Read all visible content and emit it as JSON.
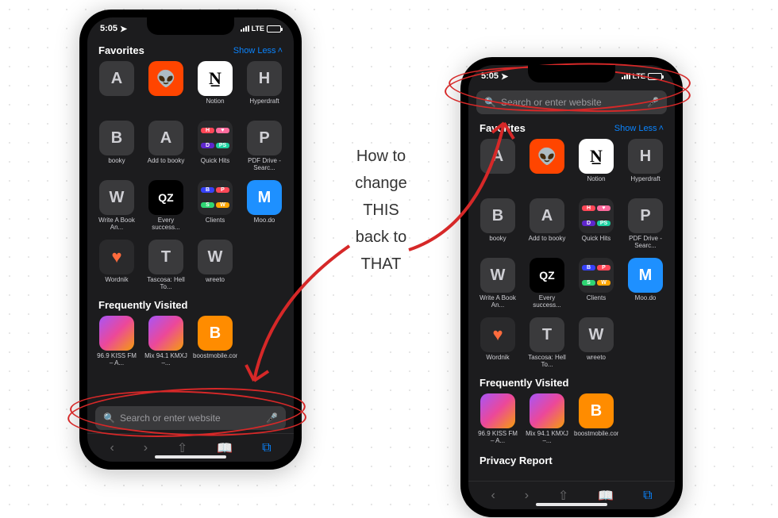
{
  "status": {
    "time": "5:05",
    "net": "LTE"
  },
  "search": {
    "placeholder": "Search or enter website"
  },
  "sections": {
    "favorites": "Favorites",
    "show_less": "Show Less",
    "frequently": "Frequently Visited",
    "privacy": "Privacy Report"
  },
  "favorites": [
    {
      "letter": "A",
      "label": "",
      "style": ""
    },
    {
      "letter": "👽",
      "label": "",
      "style": "reddit"
    },
    {
      "letter": "N",
      "label": "Notion",
      "style": "notion"
    },
    {
      "letter": "H",
      "label": "Hyperdraft",
      "style": ""
    },
    {
      "letter": "B",
      "label": "booky",
      "style": ""
    },
    {
      "letter": "A",
      "label": "Add to booky",
      "style": ""
    },
    {
      "letter": "",
      "label": "Quick Hits",
      "style": "multi-a"
    },
    {
      "letter": "P",
      "label": "PDF Drive - Searc...",
      "style": ""
    },
    {
      "letter": "W",
      "label": "Write A Book An...",
      "style": ""
    },
    {
      "letter": "QZ",
      "label": "Every success...",
      "style": "qz"
    },
    {
      "letter": "",
      "label": "Clients",
      "style": "multi-b"
    },
    {
      "letter": "M",
      "label": "Moo.do",
      "style": "moodo"
    },
    {
      "letter": "♥",
      "label": "Wordnik",
      "style": "wordnik"
    },
    {
      "letter": "T",
      "label": "Tascosa: Hell To...",
      "style": ""
    },
    {
      "letter": "W",
      "label": "wreeto",
      "style": ""
    }
  ],
  "frequent": [
    {
      "letter": "",
      "label": "96.9 KISS FM – A...",
      "style": "kiss"
    },
    {
      "letter": "",
      "label": "Mix 94.1 KMXJ –...",
      "style": "kiss"
    },
    {
      "letter": "B",
      "label": "boostmobile.com",
      "style": "boost"
    }
  ],
  "annotation": {
    "line1": "How to",
    "line2": "change",
    "line3": "THIS",
    "line4": "back to",
    "line5": "THAT"
  }
}
